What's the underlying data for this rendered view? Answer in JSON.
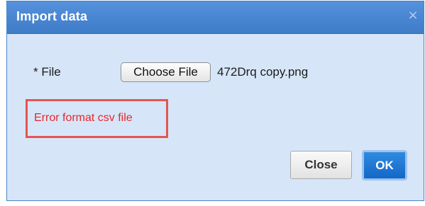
{
  "dialog": {
    "title": "Import data",
    "close_glyph": "×"
  },
  "form": {
    "file_label": "* File",
    "choose_button_label": "Choose File",
    "selected_file_name": "472Drq copy.png"
  },
  "error": {
    "message": "Error format csv file",
    "color": "#e8262b",
    "highlight_color": "#e3564f"
  },
  "buttons": {
    "close_label": "Close",
    "ok_label": "OK"
  },
  "colors": {
    "titlebar": "#4a86d2",
    "body_background": "#d6e6f8",
    "ok_button": "#1f78d4"
  },
  "icons": {
    "dialog_close": "close-icon"
  }
}
